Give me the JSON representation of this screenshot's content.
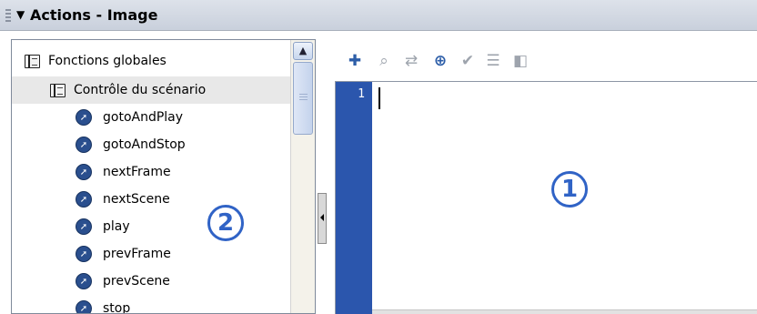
{
  "panel": {
    "collapse_arrow": "▼",
    "title": "Actions - Image"
  },
  "toolbox": {
    "scroll_up_glyph": "▲",
    "items": [
      {
        "label": "Fonctions globales",
        "icon": "book-icon"
      },
      {
        "label": "Contrôle du scénario",
        "icon": "book-icon"
      },
      {
        "label": "gotoAndPlay",
        "icon": "action-icon"
      },
      {
        "label": "gotoAndStop",
        "icon": "action-icon"
      },
      {
        "label": "nextFrame",
        "icon": "action-icon"
      },
      {
        "label": "nextScene",
        "icon": "action-icon"
      },
      {
        "label": "play",
        "icon": "action-icon"
      },
      {
        "label": "prevFrame",
        "icon": "action-icon"
      },
      {
        "label": "prevScene",
        "icon": "action-icon"
      },
      {
        "label": "stop",
        "icon": "action-icon"
      }
    ]
  },
  "toolbar": {
    "icons": [
      "add-statement-icon",
      "find-icon",
      "replace-icon",
      "insert-target-path-icon",
      "check-syntax-icon",
      "auto-format-icon",
      "code-hint-icon"
    ],
    "glyphs": [
      "✚",
      "⌕",
      "⇄",
      "⊕",
      "✔",
      "☰",
      "◧"
    ]
  },
  "editor": {
    "line_numbers": [
      "1"
    ]
  },
  "callouts": {
    "script_pane": "1",
    "actions_toolbox": "2"
  },
  "colors": {
    "gutter": "#2b56ad",
    "callout": "#3063c6",
    "selected_row": "#e8e8e8"
  }
}
